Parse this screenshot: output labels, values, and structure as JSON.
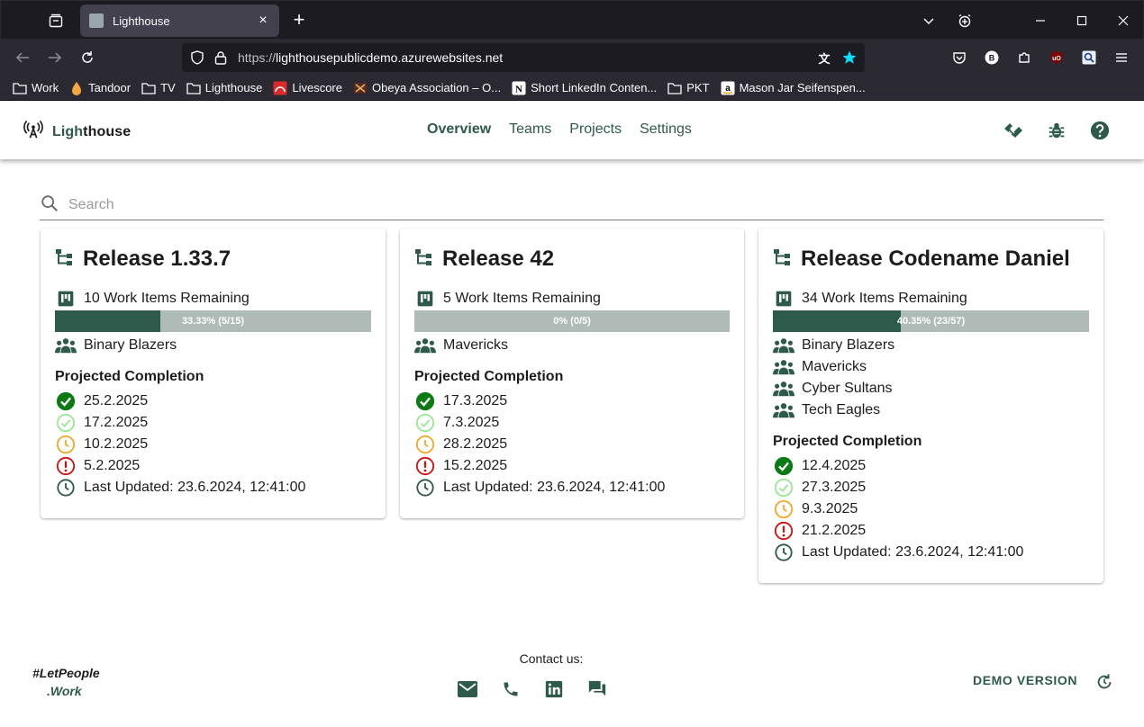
{
  "browser": {
    "tab_title": "Lighthouse",
    "url_prefix": "https://",
    "url_host": "lighthousepublicdemo.azurewebsites.net",
    "bookmarks": [
      {
        "label": "Work",
        "icon": "folder-icon"
      },
      {
        "label": "Tandoor",
        "icon": "tandoor-icon"
      },
      {
        "label": "TV",
        "icon": "folder-icon"
      },
      {
        "label": "Lighthouse",
        "icon": "folder-icon"
      },
      {
        "label": "Livescore",
        "icon": "livescore-icon"
      },
      {
        "label": "Obeya Association – O...",
        "icon": "obeya-icon"
      },
      {
        "label": "Short LinkedIn Conten...",
        "icon": "notion-icon"
      },
      {
        "label": "PKT",
        "icon": "folder-icon"
      },
      {
        "label": "Mason Jar Seifenspen...",
        "icon": "amazon-icon"
      }
    ]
  },
  "app": {
    "brand_l": "Ligh",
    "brand_rest": "thouse",
    "nav": [
      "Overview",
      "Teams",
      "Projects",
      "Settings"
    ],
    "search_placeholder": "Search",
    "accent_color": "#2e5a4c"
  },
  "projects": [
    {
      "title": "Release 1.33.7",
      "remaining": "10 Work Items Remaining",
      "progress_label": "33.33% (5/15)",
      "progress": 0.3333,
      "teams": [
        "Binary Blazers"
      ],
      "projected_label": "Projected Completion",
      "forecasts": [
        {
          "date": "25.2.2025",
          "status": "certain"
        },
        {
          "date": "17.2.2025",
          "status": "likely"
        },
        {
          "date": "10.2.2025",
          "status": "risky"
        },
        {
          "date": "5.2.2025",
          "status": "unlikely"
        }
      ],
      "last_updated": "Last Updated: 23.6.2024, 12:41:00"
    },
    {
      "title": "Release 42",
      "remaining": "5 Work Items Remaining",
      "progress_label": "0% (0/5)",
      "progress": 0,
      "teams": [
        "Mavericks"
      ],
      "projected_label": "Projected Completion",
      "forecasts": [
        {
          "date": "17.3.2025",
          "status": "certain"
        },
        {
          "date": "7.3.2025",
          "status": "likely"
        },
        {
          "date": "28.2.2025",
          "status": "risky"
        },
        {
          "date": "15.2.2025",
          "status": "unlikely"
        }
      ],
      "last_updated": "Last Updated: 23.6.2024, 12:41:00"
    },
    {
      "title": "Release Codename Daniel",
      "remaining": "34 Work Items Remaining",
      "progress_label": "40.35% (23/57)",
      "progress": 0.4035,
      "teams": [
        "Binary Blazers",
        "Mavericks",
        "Cyber Sultans",
        "Tech Eagles"
      ],
      "projected_label": "Projected Completion",
      "forecasts": [
        {
          "date": "12.4.2025",
          "status": "certain"
        },
        {
          "date": "27.3.2025",
          "status": "likely"
        },
        {
          "date": "9.3.2025",
          "status": "risky"
        },
        {
          "date": "21.2.2025",
          "status": "unlikely"
        }
      ],
      "last_updated": "Last Updated: 23.6.2024, 12:41:00"
    }
  ],
  "footer": {
    "logo_line1": "#LetPeople",
    "logo_line2": ".Work",
    "contact_label": "Contact us:",
    "demo_label": "DEMO VERSION"
  }
}
